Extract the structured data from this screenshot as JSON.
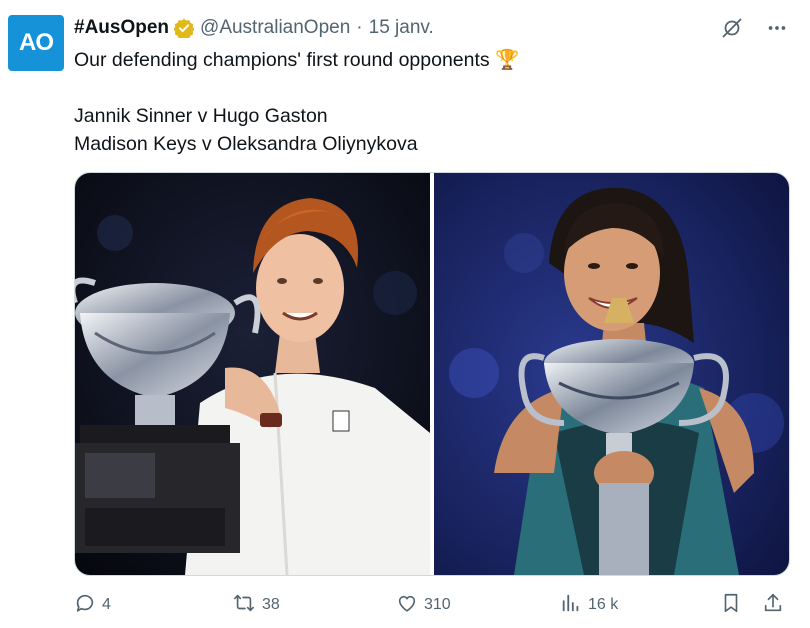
{
  "account": {
    "avatar_text": "AO",
    "display_name": "#AusOpen",
    "handle": "@AustralianOpen",
    "separator": "·",
    "date": "15 janv."
  },
  "tweet": {
    "line1": "Our defending champions' first round opponents 🏆",
    "line2": "Jannik Sinner v Hugo Gaston",
    "line3": "Madison Keys v Oleksandra Oliynykova"
  },
  "media": {
    "photos": [
      {
        "subject": "Jannik Sinner holding trophy"
      },
      {
        "subject": "Madison Keys holding trophy"
      }
    ]
  },
  "actions": {
    "reply_count": "4",
    "retweet_count": "38",
    "like_count": "310",
    "views_count": "16 k"
  },
  "colors": {
    "brand": "#1592d8",
    "muted": "#536471",
    "verified_gold": "#e2b719"
  },
  "icons": [
    "grok-icon",
    "more-icon",
    "verified-badge-icon",
    "reply-icon",
    "retweet-icon",
    "like-icon",
    "views-icon",
    "bookmark-icon",
    "share-icon"
  ]
}
